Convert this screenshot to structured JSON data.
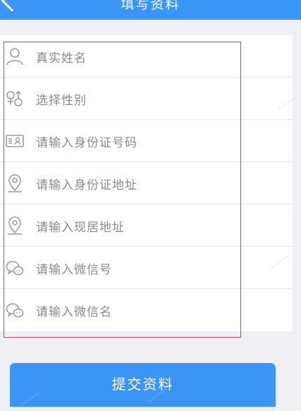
{
  "header": {
    "title": "填写资料",
    "back_icon": "chevron-left-icon"
  },
  "form": {
    "fields": [
      {
        "key": "real_name",
        "placeholder": "真实姓名",
        "icon": "user-icon"
      },
      {
        "key": "gender",
        "placeholder": "选择性别",
        "icon": "gender-icon"
      },
      {
        "key": "id_number",
        "placeholder": "请输入身份证号码",
        "icon": "id-card-icon"
      },
      {
        "key": "id_address",
        "placeholder": "请输入身份证地址",
        "icon": "location-pin-icon"
      },
      {
        "key": "current_address",
        "placeholder": "请输入现居地址",
        "icon": "location-pin-icon"
      },
      {
        "key": "wechat_id",
        "placeholder": "请输入微信号",
        "icon": "wechat-icon"
      },
      {
        "key": "wechat_name",
        "placeholder": "请输入微信名",
        "icon": "wechat-icon"
      }
    ]
  },
  "submit": {
    "label": "提交资料"
  },
  "colors": {
    "primary": "#3a95f5",
    "background": "#efeff4",
    "placeholder_text": "#8b8b8b",
    "highlight_outline": "#b34a55"
  }
}
